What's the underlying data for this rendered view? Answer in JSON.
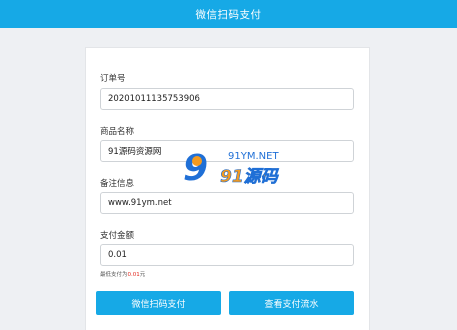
{
  "header": {
    "title": "微信扫码支付"
  },
  "form": {
    "order_no": {
      "label": "订单号",
      "value": "20201011135753906"
    },
    "product": {
      "label": "商品名称",
      "value": "91源码资源网"
    },
    "note": {
      "label": "备注信息",
      "value": "www.91ym.net"
    },
    "amount": {
      "label": "支付金额",
      "value": "0.01"
    },
    "hint": {
      "prefix": "最低支付为",
      "amount": "0.01",
      "suffix": "元"
    }
  },
  "buttons": {
    "pay": "微信扫码支付",
    "flow": "查看支付流水"
  },
  "watermark": {
    "top_text": "91YM.NET",
    "bottom_text": "91源码",
    "digit": "9"
  },
  "colors": {
    "accent": "#16a9e6",
    "hint_red": "#e3261c",
    "watermark_orange": "#f39a1f",
    "watermark_blue": "#1f6fd6"
  }
}
